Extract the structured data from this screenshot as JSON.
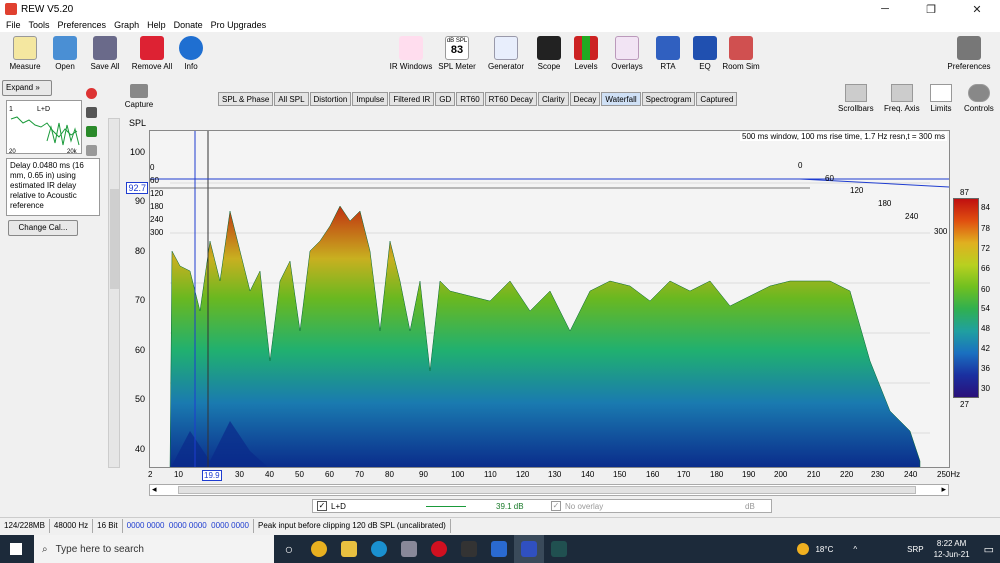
{
  "window": {
    "title": "REW V5.20",
    "minimize": "─",
    "maximize": "❐",
    "close": "✕"
  },
  "menu": [
    "File",
    "Tools",
    "Preferences",
    "Graph",
    "Help",
    "Donate",
    "Pro Upgrades"
  ],
  "toolbar_left": [
    "Measure",
    "Open",
    "Save All",
    "Remove All",
    "Info"
  ],
  "toolbar_center": [
    "IR Windows",
    "SPL Meter",
    "Generator",
    "Scope",
    "Levels",
    "Overlays",
    "RTA",
    "EQ",
    "Room Sim"
  ],
  "spl_meter": {
    "caption": "dB SPL",
    "value": "83"
  },
  "preferences_label": "Preferences",
  "expand_label": "Expand",
  "thumbnail": {
    "label": "L+D",
    "ytop": "1",
    "xleft": "20",
    "xright": "20k"
  },
  "delay_text": "Delay 0.0480 ms (16 mm, 0.65 in) using estimated IR delay relative to Acoustic reference",
  "change_cal_label": "Change Cal...",
  "capture_label": "Capture",
  "tabs": [
    "SPL & Phase",
    "All SPL",
    "Distortion",
    "Impulse",
    "Filtered IR",
    "GD",
    "RT60",
    "RT60 Decay",
    "Clarity",
    "Decay",
    "Waterfall",
    "Spectrogram",
    "Captured"
  ],
  "active_tab": "Waterfall",
  "right_tools": [
    "Scrollbars",
    "Freq. Axis",
    "Limits",
    "Controls"
  ],
  "graph": {
    "ylabel": "SPL",
    "yticks": [
      "100",
      "90",
      "80",
      "70",
      "60",
      "50",
      "40"
    ],
    "cursor_value": "92.7",
    "xticks": [
      "2",
      "10",
      "19.9",
      "30",
      "40",
      "50",
      "60",
      "70",
      "80",
      "90",
      "100",
      "110",
      "120",
      "130",
      "140",
      "150",
      "160",
      "170",
      "180",
      "190",
      "200",
      "210",
      "220",
      "230",
      "240",
      "250Hz"
    ],
    "info": "500 ms window, 100 ms rise time,  1.7 Hz resn,t = 300 ms",
    "time_ticks_left": [
      "0",
      "60",
      "120",
      "180",
      "240",
      "300"
    ],
    "time_ticks_right": [
      "0",
      "60",
      "120",
      "180",
      "240",
      "300"
    ]
  },
  "colorbar": {
    "ticks": [
      "87",
      "84",
      "78",
      "72",
      "66",
      "60",
      "54",
      "48",
      "42",
      "36",
      "30",
      "27"
    ]
  },
  "legend": {
    "name": "L+D",
    "value": "39.1 dB",
    "overlay": "No overlay",
    "unit": "dB"
  },
  "status": [
    "124/228MB",
    "48000 Hz",
    "16 Bit",
    "0000 0000  0000 0000  0000 0000",
    "Peak input before clipping 120 dB SPL (uncalibrated)"
  ],
  "taskbar": {
    "search": "Type here to search",
    "temp": "18°C",
    "lang": "SRP",
    "time": "8:22 AM",
    "date": "12-Jun-21"
  },
  "colors": {
    "accent": "#0078d7",
    "taskbar": "#1c2a3a",
    "cursor": "#1e3cd0"
  }
}
